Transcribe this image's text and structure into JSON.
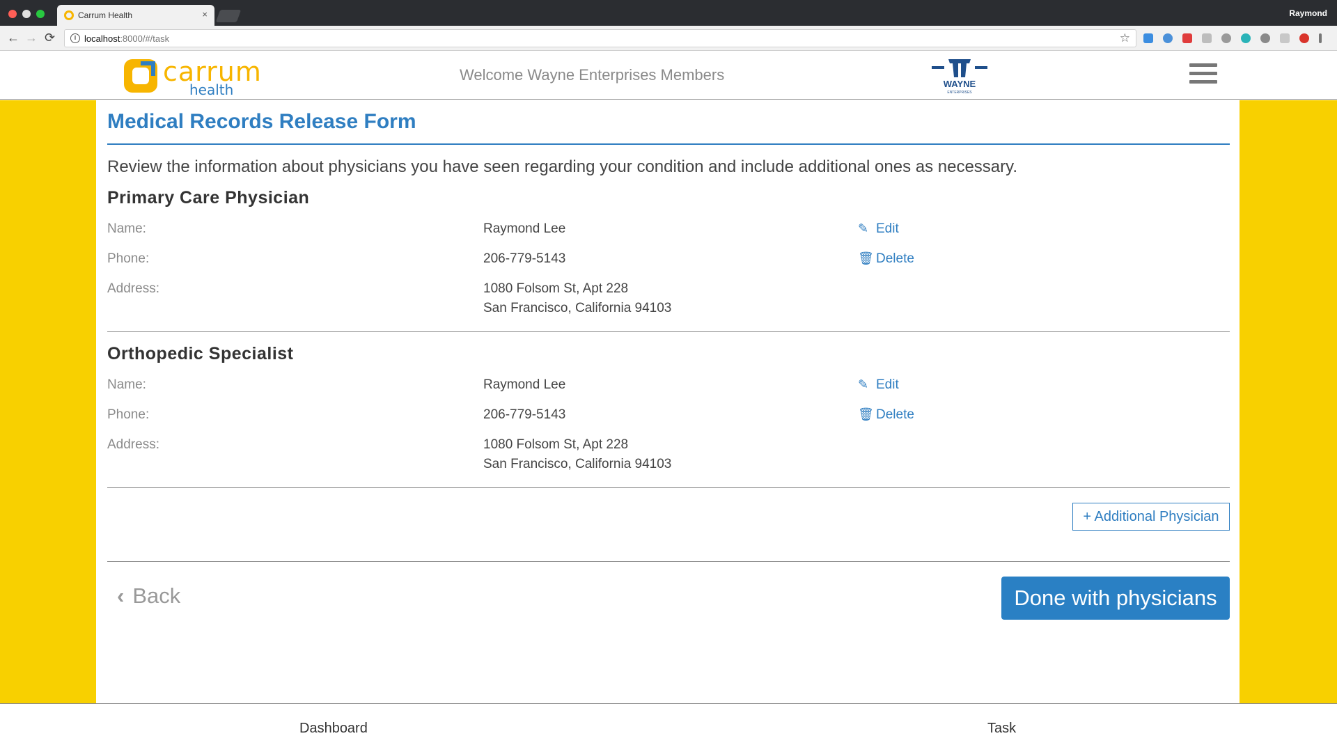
{
  "browser": {
    "tab_title": "Carrum Health",
    "tab_close": "×",
    "profile_name": "Raymond",
    "url_host": "localhost",
    "url_rest": ":8000/#/task",
    "back_icon": "←",
    "forward_icon": "→",
    "reload_icon": "⟳",
    "star_icon": "☆",
    "info_icon": "i"
  },
  "header": {
    "logo_word": "carrum",
    "logo_sub": "health",
    "welcome": "Welcome Wayne Enterprises Members",
    "wayne_name": "WAYNE",
    "wayne_sub": "ENTERPRISES",
    "brand_yellow": "#f8d000",
    "brand_blue": "#2f7ec1"
  },
  "form": {
    "title": "Medical Records Release Form",
    "intro": "Review the information about physicians you have seen regarding your condition and include additional ones as necessary.",
    "labels": {
      "name": "Name:",
      "phone": "Phone:",
      "address": "Address:"
    },
    "actions": {
      "edit": "Edit",
      "delete": "Delete"
    },
    "physicians": [
      {
        "role": "Primary Care Physician",
        "name": "Raymond Lee",
        "phone": "206-779-5143",
        "address_line1": "1080 Folsom St, Apt 228",
        "address_line2": "San Francisco, California 94103"
      },
      {
        "role": "Orthopedic Specialist",
        "name": "Raymond Lee",
        "phone": "206-779-5143",
        "address_line1": "1080 Folsom St, Apt 228",
        "address_line2": "San Francisco, California 94103"
      }
    ],
    "add_button": "+ Additional Physician",
    "back_label": "Back",
    "done_button": "Done with physicians"
  },
  "footer": {
    "dashboard": "Dashboard",
    "task": "Task"
  }
}
